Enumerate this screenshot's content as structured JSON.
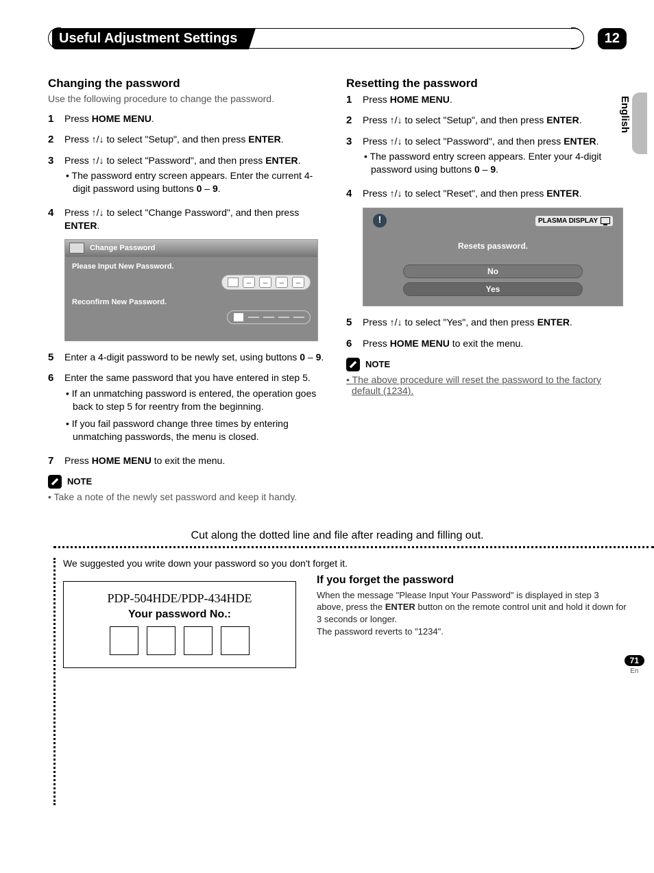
{
  "header": {
    "title": "Useful Adjustment Settings",
    "chapter": "12"
  },
  "side_tab": "English",
  "left": {
    "heading": "Changing the password",
    "sub": "Use the following procedure to change the password.",
    "steps": [
      {
        "n": "1",
        "pre": "Press ",
        "b1": "HOME MENU",
        "post": "."
      },
      {
        "n": "2",
        "t": "Press ↑/↓ to select \"Setup\", and then press ",
        "b1": "ENTER",
        "post": "."
      },
      {
        "n": "3",
        "t": "Press ↑/↓ to select \"Password\", and then press ",
        "b1": "ENTER",
        "post": ".",
        "sub": "The password entry screen appears. Enter the current 4-digit password using buttons ",
        "b2": "0",
        "mid": " – ",
        "b3": "9",
        "post2": "."
      },
      {
        "n": "4",
        "t": "Press ↑/↓ to select \"Change Password\", and then press ",
        "b1": "ENTER",
        "post": "."
      },
      {
        "n": "5",
        "plain": "Enter a 4-digit password to be newly set, using buttons ",
        "b1": "0",
        "mid": " – ",
        "b2": "9",
        "post": "."
      },
      {
        "n": "6",
        "plain": "Enter the same password that you have entered in step 5.",
        "subs": [
          "If an unmatching password is entered, the operation goes back to step 5 for reentry from the beginning.",
          "If you fail password change three times by entering unmatching passwords, the menu is closed."
        ]
      },
      {
        "n": "7",
        "pre": "Press ",
        "b1": "HOME MENU",
        "post": " to exit the menu."
      }
    ],
    "osd": {
      "title": "Change Password",
      "l1": "Please Input New Password.",
      "l2": "Reconfirm New Password."
    },
    "note_label": "NOTE",
    "note_text": "Take a note of the newly set password and keep it handy."
  },
  "right": {
    "heading": "Resetting the password",
    "steps": [
      {
        "n": "1",
        "pre": "Press ",
        "b1": "HOME MENU",
        "post": "."
      },
      {
        "n": "2",
        "t": "Press ↑/↓ to select \"Setup\", and then press ",
        "b1": "ENTER",
        "post": "."
      },
      {
        "n": "3",
        "t": "Press ↑/↓ to select \"Password\", and then press ",
        "b1": "ENTER",
        "post": ".",
        "sub": "The password entry screen appears. Enter your 4-digit password using buttons ",
        "b2": "0",
        "mid": " – ",
        "b3": "9",
        "post2": "."
      },
      {
        "n": "4",
        "t": "Press ↑/↓ to select \"Reset\", and then press ",
        "b1": "ENTER",
        "post": "."
      },
      {
        "n": "5",
        "t": "Press ↑/↓ to select \"Yes\", and then press ",
        "b1": "ENTER",
        "post": "."
      },
      {
        "n": "6",
        "pre": "Press ",
        "b1": "HOME MENU",
        "post": " to exit the menu."
      }
    ],
    "osd": {
      "plasma": "PLASMA DISPLAY",
      "msg": "Resets password.",
      "no": "No",
      "yes": "Yes"
    },
    "note_label": "NOTE",
    "note_text": "The above procedure will reset the password to the factory default (1234)."
  },
  "cut": {
    "headline": "Cut along the dotted line and file after reading and filling out.",
    "intro": "We suggested you write down your password so you don't forget it.",
    "model": "PDP-504HDE/PDP-434HDE",
    "pw_label": "Your password No.:",
    "forget_h": "If you forget the password",
    "forget_p1": "When the message \"Please Input Your Password\" is displayed in step 3 above, press the ",
    "forget_b": "ENTER",
    "forget_p2": " button on the remote control unit and hold it down for 3 seconds or longer.",
    "forget_p3": "The password reverts to \"1234\"."
  },
  "footer": {
    "page": "71",
    "lang": "En"
  }
}
